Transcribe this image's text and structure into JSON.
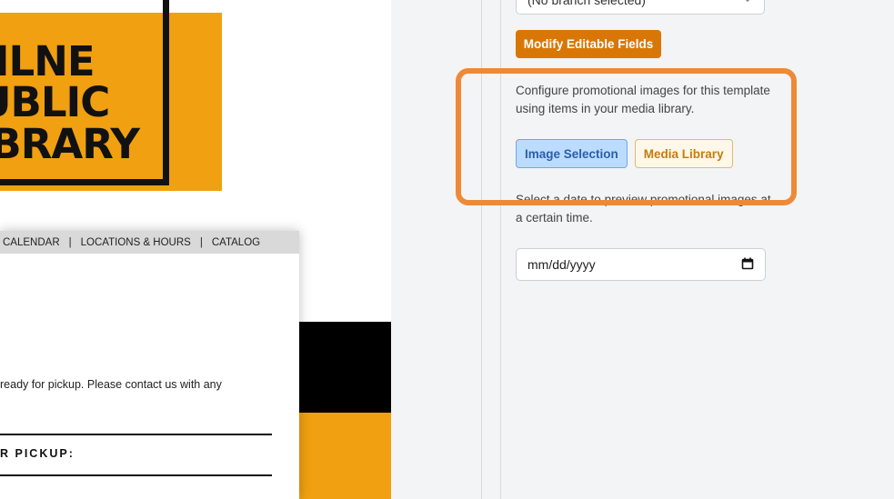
{
  "logo": {
    "line1": "MILNE",
    "line2": "PUBLIC",
    "line3": "LIBRARY"
  },
  "email": {
    "nav": [
      "CALENDAR",
      "LOCATIONS & HOURS",
      "CATALOG"
    ],
    "nav_separator": "|",
    "body_text": "ready for pickup. Please contact us with any",
    "pickup_heading": "R PICKUP:"
  },
  "panel": {
    "branch_select_value": "(No branch selected)",
    "modify_button": "Modify Editable Fields",
    "promo_description": "Configure promotional images for this template using items in your media library.",
    "image_selection_button": "Image Selection",
    "media_library_button": "Media Library",
    "preview_description": "Select a date to preview promotional images at a certain time.",
    "date_placeholder": "mm/dd/yyyy"
  },
  "colors": {
    "brand_orange": "#d97706",
    "logo_orange": "#f0a010",
    "highlight": "#ee8a37",
    "selected_blue": "#bcdcff"
  },
  "icons": {
    "select_chevron": "chevron-down-icon",
    "calendar": "calendar-icon"
  }
}
